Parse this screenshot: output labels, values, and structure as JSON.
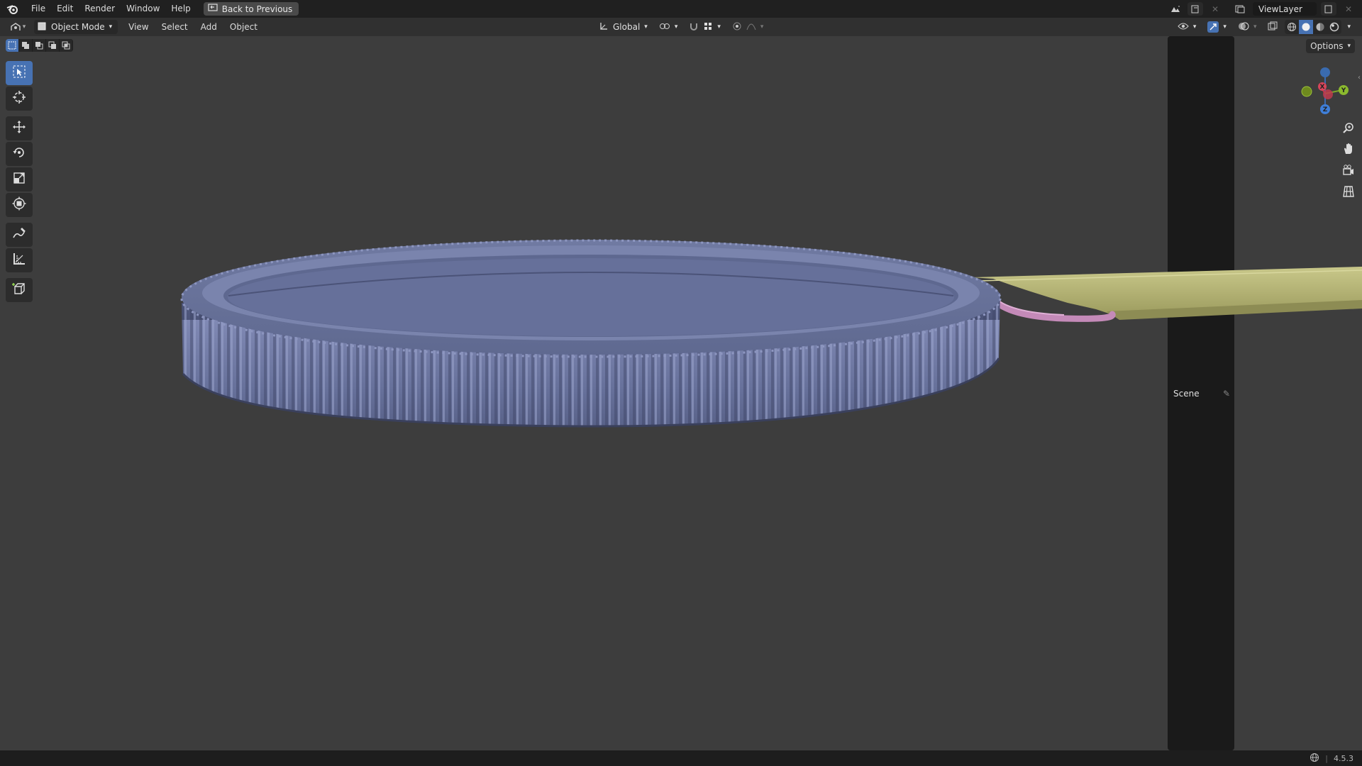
{
  "topbar": {
    "menus": [
      "File",
      "Edit",
      "Render",
      "Window",
      "Help"
    ],
    "back_label": "Back to Previous",
    "scene_name": "Scene",
    "view_layer": "ViewLayer"
  },
  "viewport_header": {
    "mode": "Object Mode",
    "menus": [
      "View",
      "Select",
      "Add",
      "Object"
    ],
    "orientation": "Global"
  },
  "options_label": "Options",
  "gizmo": {
    "x": "X",
    "y": "Y",
    "z": "Z"
  },
  "statusbar": {
    "version": "4.5.3"
  },
  "colors": {
    "accent": "#4772b3",
    "background": "#3d3d3d",
    "coin": "#6b749c",
    "strap": "#b8b774",
    "ring": "#c48ab8"
  },
  "icons": {
    "toolbar": [
      "select-box-icon",
      "cursor-icon",
      "move-icon",
      "rotate-icon",
      "scale-icon",
      "transform-icon",
      "annotate-icon",
      "measure-icon",
      "add-cube-icon"
    ],
    "nav": [
      "zoom-icon",
      "pan-hand-icon",
      "camera-icon",
      "grid-icon"
    ]
  }
}
